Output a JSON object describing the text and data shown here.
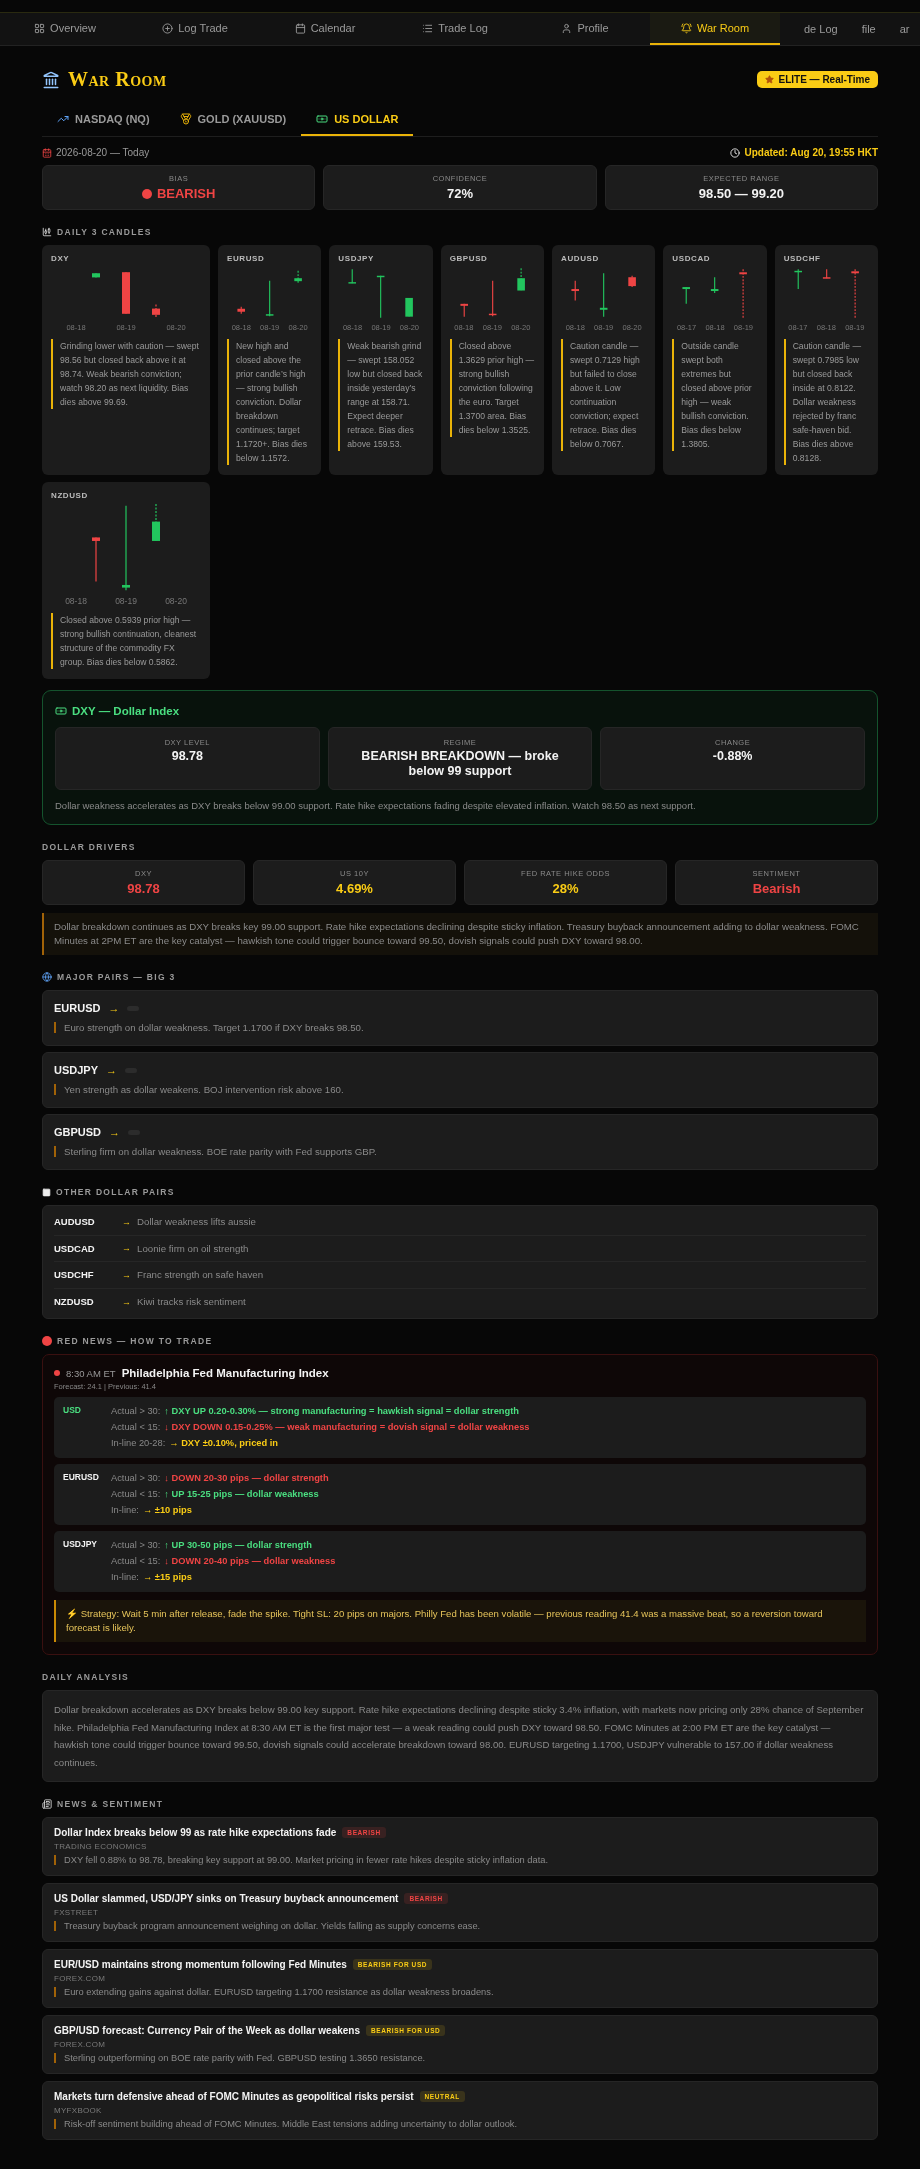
{
  "nav": {
    "items": [
      {
        "label": "Overview",
        "selected": false
      },
      {
        "label": "Log Trade",
        "selected": false
      },
      {
        "label": "Calendar",
        "selected": false
      },
      {
        "label": "Trade Log",
        "selected": false
      },
      {
        "label": "Profile",
        "selected": false
      },
      {
        "label": "War Room",
        "selected": true
      }
    ],
    "overflow": [
      "de Log",
      "file",
      "ar"
    ]
  },
  "header": {
    "title": "War Room",
    "badge": "ELITE — Real-Time"
  },
  "instrument_tabs": [
    {
      "label": "NASDAQ (NQ)",
      "selected": false
    },
    {
      "label": "GOLD (XAUUSD)",
      "selected": false
    },
    {
      "label": "US DOLLAR",
      "selected": true
    }
  ],
  "date": "2026-08-20 — Today",
  "updated": "Updated: Aug 20, 19:55 HKT",
  "summary": [
    {
      "label": "BIAS",
      "value": "BEARISH",
      "kind": "signal",
      "color": "#ef4444"
    },
    {
      "label": "CONFIDENCE",
      "value": "72%",
      "kind": "plain",
      "color": "#f3f3f3"
    },
    {
      "label": "EXPECTED RANGE",
      "value": "98.50 — 99.20",
      "kind": "plain",
      "color": "#f3f3f3"
    }
  ],
  "candles": {
    "title": "DAILY 3 CANDLES",
    "cards": [
      {
        "pair": "DXY",
        "dates": [
          "08-18",
          "08-19",
          "08-20"
        ],
        "note": "Grinding lower with caution — swept 98.56 but closed back above it at 98.74. Weak bearish conviction; watch 98.20 as next liquidity. Bias dies above 99.69."
      },
      {
        "pair": "EURUSD",
        "dates": [
          "08-18",
          "08-19",
          "08-20"
        ],
        "note": "New high and closed above the prior candle’s high — strong bullish conviction. Dollar breakdown continues; target 1.1720+. Bias dies below 1.1572."
      },
      {
        "pair": "USDJPY",
        "dates": [
          "08-18",
          "08-19",
          "08-20"
        ],
        "note": "Weak bearish grind — swept 158.052 low but closed back inside yesterday’s range at 158.71. Expect deeper retrace. Bias dies above 159.53."
      },
      {
        "pair": "GBPUSD",
        "dates": [
          "08-18",
          "08-19",
          "08-20"
        ],
        "note": "Closed above 1.3629 prior high — strong bullish conviction following the euro. Target 1.3700 area. Bias dies below 1.3525."
      },
      {
        "pair": "AUDUSD",
        "dates": [
          "08-18",
          "08-19",
          "08-20"
        ],
        "note": "Caution candle — swept 0.7129 high but failed to close above it. Low continuation conviction; expect retrace. Bias dies below 0.7067."
      },
      {
        "pair": "USDCAD",
        "dates": [
          "08-17",
          "08-18",
          "08-19"
        ],
        "note": "Outside candle swept both extremes but closed above prior high — weak bullish conviction. Bias dies below 1.3805."
      },
      {
        "pair": "USDCHF",
        "dates": [
          "08-17",
          "08-18",
          "08-19"
        ],
        "note": "Caution candle — swept 0.7985 low but closed back inside at 0.8122. Dollar weakness rejected by franc safe-haven bid. Bias dies above 0.8128."
      },
      {
        "pair": "NZDUSD",
        "dates": [
          "08-18",
          "08-19",
          "08-20"
        ],
        "note": "Closed above 0.5939 prior high — strong bullish continuation, cleanest structure of the commodity FX group. Bias dies below 0.5862."
      }
    ]
  },
  "dxy_panel": {
    "title": "DXY — Dollar Index",
    "stats": [
      {
        "label": "DXY LEVEL",
        "value": "98.78"
      },
      {
        "label": "REGIME",
        "value": "BEARISH BREAKDOWN — broke below 99 support"
      },
      {
        "label": "CHANGE",
        "value": "-0.88%"
      }
    ],
    "note": "Dollar weakness accelerates as DXY breaks below 99.00 support. Rate hike expectations fading despite elevated inflation. Watch 98.50 as next support."
  },
  "drivers": {
    "title": "DOLLAR DRIVERS",
    "items": [
      {
        "label": "DXY",
        "value": "98.78",
        "color": "#ef4444"
      },
      {
        "label": "US 10Y",
        "value": "4.69%",
        "color": "#facc15"
      },
      {
        "label": "FED RATE HIKE ODDS",
        "value": "28%",
        "color": "#facc15"
      },
      {
        "label": "SENTIMENT",
        "value": "Bearish",
        "color": "#ef4444"
      }
    ],
    "note": "Dollar breakdown continues as DXY breaks key 99.00 support. Rate hike expectations declining despite sticky inflation. Treasury buyback announcement adding to dollar weakness. FOMC Minutes at 2PM ET are the key catalyst — hawkish tone could trigger bounce toward 99.50, dovish signals could push DXY toward 98.00."
  },
  "major_pairs": {
    "title": "MAJOR PAIRS — BIG 3",
    "items": [
      {
        "pair": "EURUSD",
        "arrow": "→",
        "note": "Euro strength on dollar weakness. Target 1.1700 if DXY breaks 98.50."
      },
      {
        "pair": "USDJPY",
        "arrow": "→",
        "note": "Yen strength as dollar weakens. BOJ intervention risk above 160."
      },
      {
        "pair": "GBPUSD",
        "arrow": "→",
        "note": "Sterling firm on dollar weakness. BOE rate parity with Fed supports GBP."
      }
    ]
  },
  "other_pairs": {
    "title": "OTHER DOLLAR PAIRS",
    "items": [
      {
        "pair": "AUDUSD",
        "arrow": "→",
        "note": "Dollar weakness lifts aussie"
      },
      {
        "pair": "USDCAD",
        "arrow": "→",
        "note": "Loonie firm on oil strength"
      },
      {
        "pair": "USDCHF",
        "arrow": "→",
        "note": "Franc strength on safe haven"
      },
      {
        "pair": "NZDUSD",
        "arrow": "→",
        "note": "Kiwi tracks risk sentiment"
      }
    ]
  },
  "red_news": {
    "title": "RED NEWS — HOW TO TRADE",
    "time": "8:30 AM ET",
    "event": "Philadelphia Fed Manufacturing Index",
    "meta": "Forecast: 24.1 | Previous: 41.4",
    "blocks": [
      {
        "asset": "USD",
        "color": "#4ade80",
        "lines": [
          {
            "label": "Actual > 30:",
            "text": "↑ DXY UP 0.20-0.30% — strong manufacturing = hawkish signal = dollar strength",
            "color": "#4ade80"
          },
          {
            "label": "Actual < 15:",
            "text": "↓ DXY DOWN 0.15-0.25% — weak manufacturing = dovish signal = dollar weakness",
            "color": "#ef4444"
          },
          {
            "label": "In-line 20-28:",
            "text": "→ DXY ±0.10%, priced in",
            "color": "#facc15"
          }
        ]
      },
      {
        "asset": "EURUSD",
        "color": "#f3f3f3",
        "lines": [
          {
            "label": "Actual > 30:",
            "text": "↓ DOWN 20-30 pips — dollar strength",
            "color": "#ef4444"
          },
          {
            "label": "Actual < 15:",
            "text": "↑ UP 15-25 pips — dollar weakness",
            "color": "#4ade80"
          },
          {
            "label": "In-line:",
            "text": "→ ±10 pips",
            "color": "#facc15"
          }
        ]
      },
      {
        "asset": "USDJPY",
        "color": "#f3f3f3",
        "lines": [
          {
            "label": "Actual > 30:",
            "text": "↑ UP 30-50 pips — dollar strength",
            "color": "#4ade80"
          },
          {
            "label": "Actual < 15:",
            "text": "↓ DOWN 20-40 pips — dollar weakness",
            "color": "#ef4444"
          },
          {
            "label": "In-line:",
            "text": "→ ±15 pips",
            "color": "#facc15"
          }
        ]
      }
    ],
    "strategy": "⚡ Strategy: Wait 5 min after release, fade the spike. Tight SL: 20 pips on majors. Philly Fed has been volatile — previous reading 41.4 was a massive beat, so a reversion toward forecast is likely."
  },
  "daily_analysis": {
    "title": "DAILY ANALYSIS",
    "text": "Dollar breakdown accelerates as DXY breaks below 99.00 key support. Rate hike expectations declining despite sticky 3.4% inflation, with markets now pricing only 28% chance of September hike. Philadelphia Fed Manufacturing Index at 8:30 AM ET is the first major test — a weak reading could push DXY toward 98.50. FOMC Minutes at 2:00 PM ET are the key catalyst — hawkish tone could trigger bounce toward 99.50, dovish signals could accelerate breakdown toward 98.00. EURUSD targeting 1.1700, USDJPY vulnerable to 157.00 if dollar weakness continues."
  },
  "news": {
    "title": "NEWS & SENTIMENT",
    "items": [
      {
        "headline": "Dollar Index breaks below 99 as rate hike expectations fade",
        "tag": "BEARISH",
        "color": "#ef4444",
        "source": "TRADING ECONOMICS",
        "summary": "DXY fell 0.88% to 98.78, breaking key support at 99.00. Market pricing in fewer rate hikes despite sticky inflation data."
      },
      {
        "headline": "US Dollar slammed, USD/JPY sinks on Treasury buyback announcement",
        "tag": "BEARISH",
        "color": "#ef4444",
        "source": "FXSTREET",
        "summary": "Treasury buyback program announcement weighing on dollar. Yields falling as supply concerns ease."
      },
      {
        "headline": "EUR/USD maintains strong momentum following Fed Minutes",
        "tag": "BEARISH FOR USD",
        "color": "#facc15",
        "source": "FOREX.COM",
        "summary": "Euro extending gains against dollar. EURUSD targeting 1.1700 resistance as dollar weakness broadens."
      },
      {
        "headline": "GBP/USD forecast: Currency Pair of the Week as dollar weakens",
        "tag": "BEARISH FOR USD",
        "color": "#facc15",
        "source": "FOREX.COM",
        "summary": "Sterling outperforming on BOE rate parity with Fed. GBPUSD testing 1.3650 resistance."
      },
      {
        "headline": "Markets turn defensive ahead of FOMC Minutes as geopolitical risks persist",
        "tag": "NEUTRAL",
        "color": "#facc15",
        "source": "MYFXBOOK",
        "summary": "Risk-off sentiment building ahead of FOMC Minutes. Middle East tensions adding uncertainty to dollar outlook."
      }
    ]
  }
}
